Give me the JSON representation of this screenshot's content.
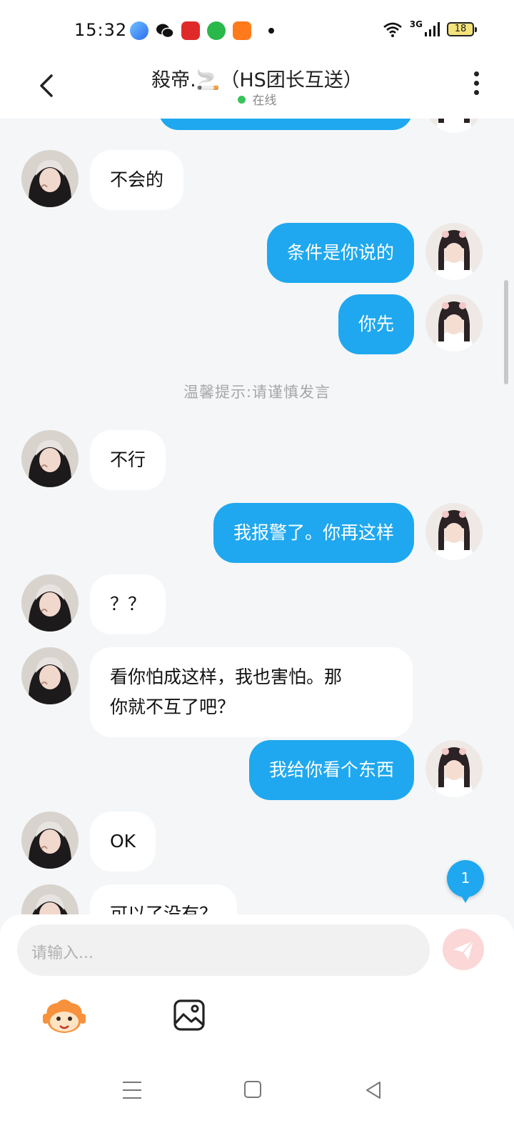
{
  "status_bar": {
    "time": "15:32",
    "network": "3G",
    "battery": "18",
    "app_icons": [
      "browser-icon",
      "wechat-icon",
      "app-red-icon",
      "app-green-icon",
      "app-orange-icon"
    ]
  },
  "header": {
    "title": "殺帝.🚬（HS团长互送）",
    "status": "在线",
    "online_color": "#3ac25a"
  },
  "colors": {
    "outgoing_bubble": "#1fa8ef",
    "incoming_bubble": "#ffffff",
    "background": "#f4f6f8"
  },
  "messages": [
    {
      "side": "in",
      "text": "不会的"
    },
    {
      "side": "out",
      "text": "条件是你说的"
    },
    {
      "side": "out",
      "text": "你先"
    },
    {
      "side": "in",
      "text": "不行"
    },
    {
      "side": "out",
      "text": "我报警了。你再这样"
    },
    {
      "side": "in",
      "text": "？？"
    },
    {
      "side": "in",
      "text_line1": "看你怕成这样，我也害怕。那",
      "text_line2": "你就不互了吧？"
    },
    {
      "side": "out",
      "text": "我给你看个东西"
    },
    {
      "side": "in",
      "text": "OK"
    },
    {
      "side": "in",
      "text": "可以了没有？"
    }
  ],
  "tip": "温馨提示:请谨慎发言",
  "new_message_badge": "1",
  "input": {
    "placeholder": "请输入..."
  }
}
